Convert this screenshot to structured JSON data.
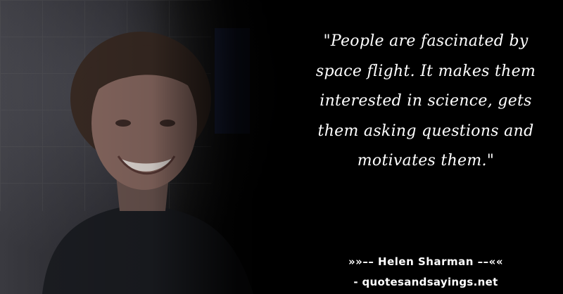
{
  "quote": {
    "text": "\"People are fascinated by space flight. It makes them interested in science, gets them asking questions and motivates them.\""
  },
  "attribution": {
    "author_line": "»»–– Helen Sharman ––««",
    "site_line": "- quotesandsayings.net"
  },
  "colors": {
    "background": "#000000",
    "text": "#ffffff"
  },
  "photo": {
    "subject": "portrait of a smiling short-haired woman"
  }
}
